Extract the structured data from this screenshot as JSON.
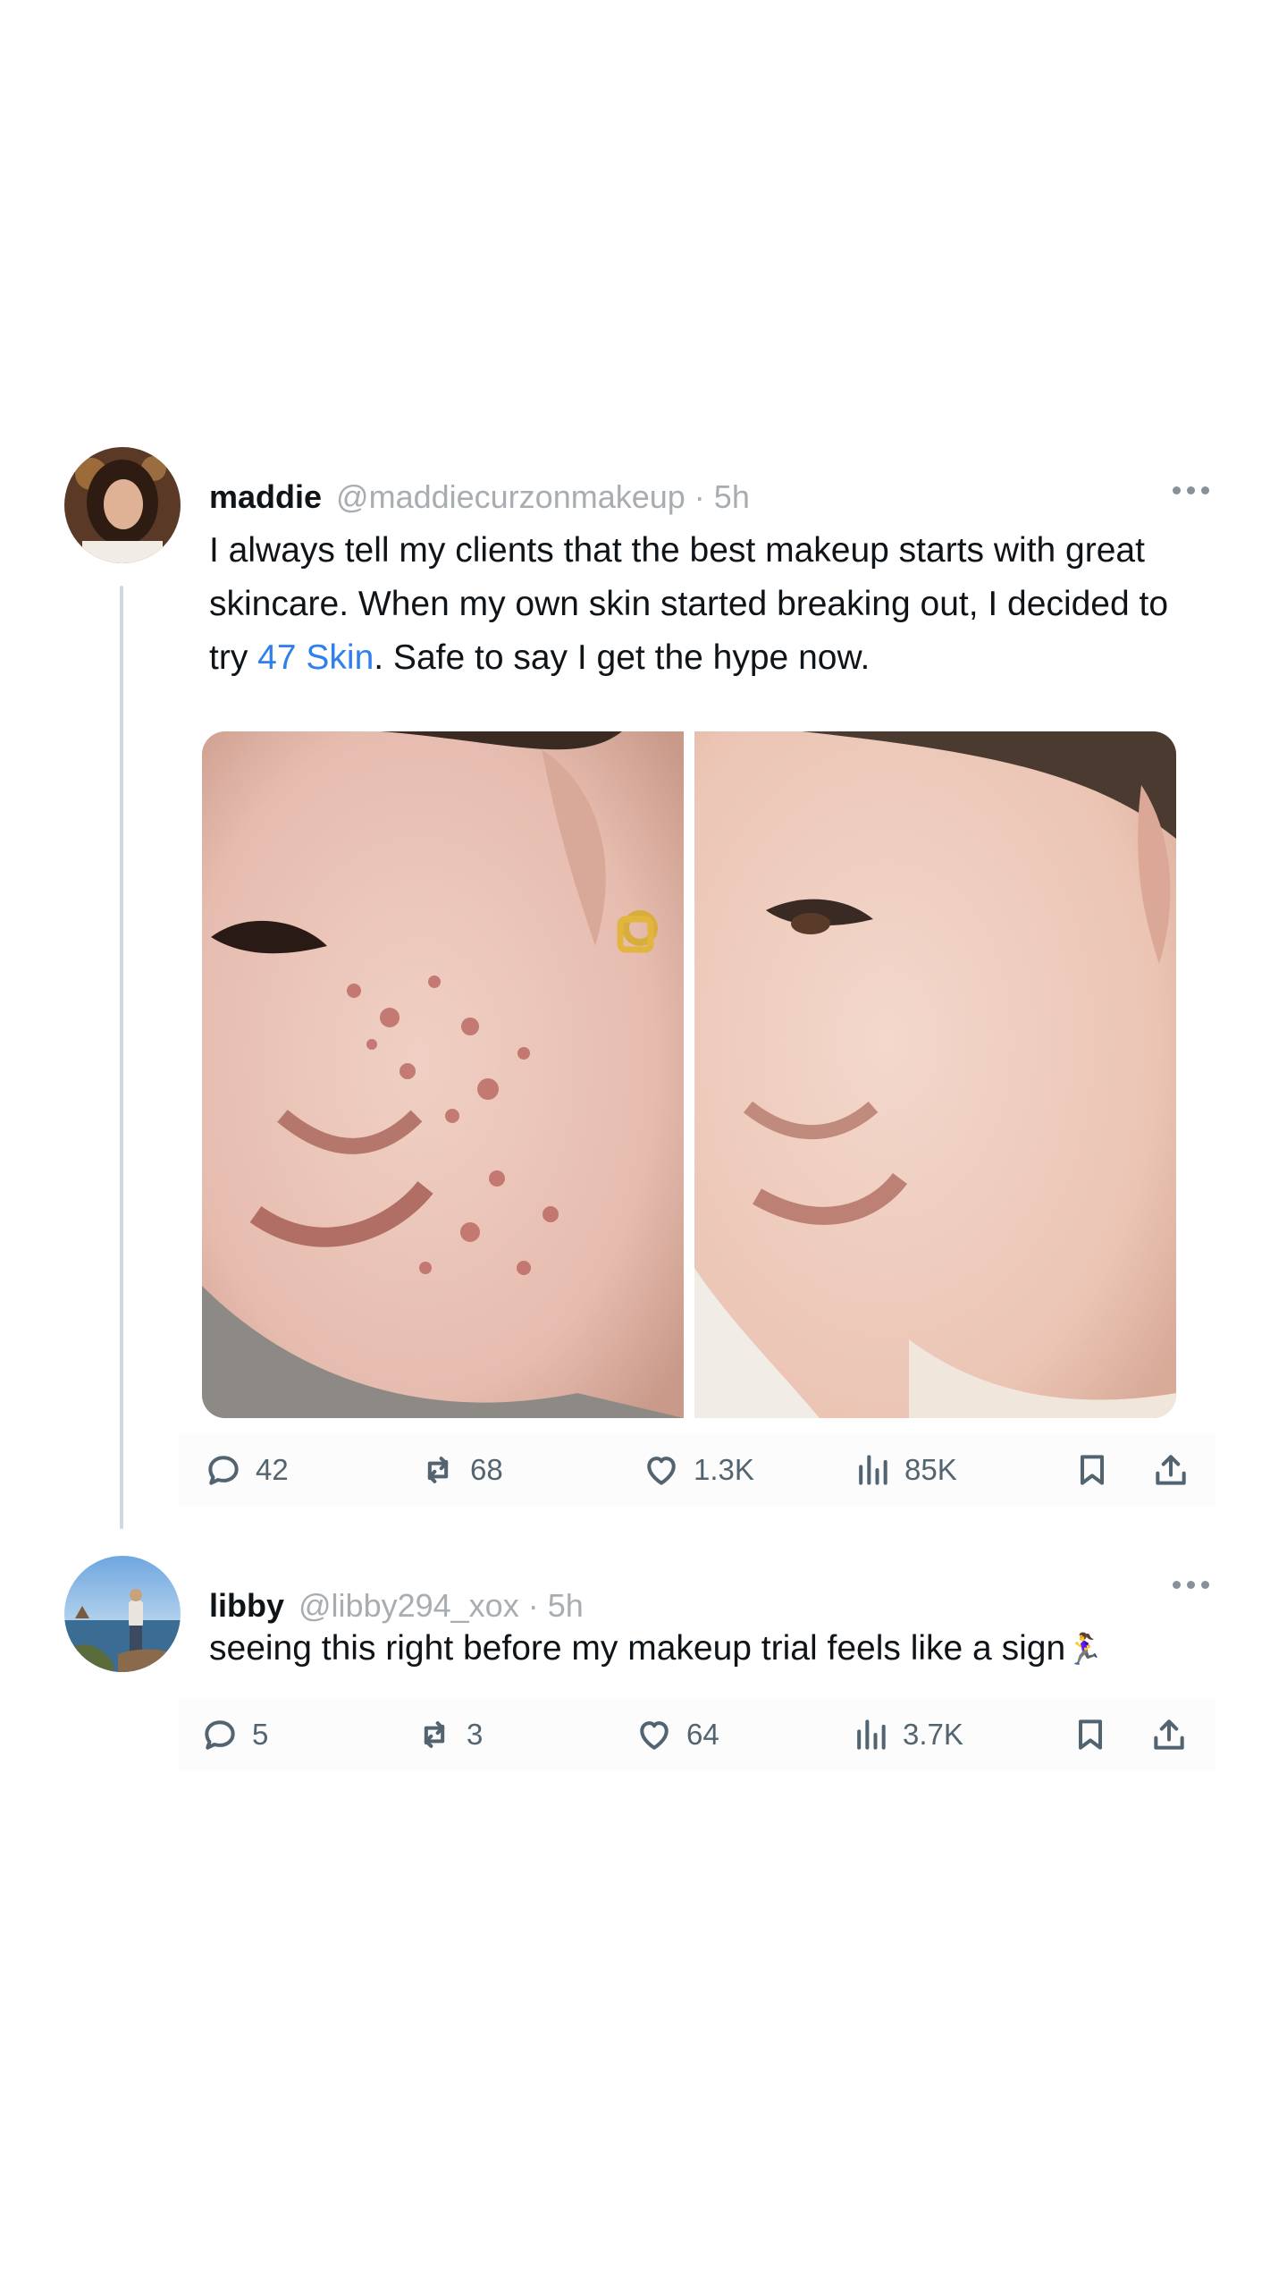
{
  "posts": [
    {
      "display_name": "maddie",
      "handle": "@maddiecurzonmakeup",
      "separator": "·",
      "time": "5h",
      "text_before": "I always tell my clients that the best makeup starts with great skincare. When my own skin started breaking out, I decided to try ",
      "link_text": "47 Skin",
      "text_after": ". Safe to say I get the hype now.",
      "media": [
        "before-photo",
        "after-photo"
      ],
      "stats": {
        "replies": "42",
        "reposts": "68",
        "likes": "1.3K",
        "views": "85K"
      }
    },
    {
      "display_name": "libby",
      "handle": "@libby294_xox",
      "separator": "·",
      "time": "5h",
      "text": "seeing this right before my makeup trial feels like a sign",
      "emoji": "🏃‍♀️",
      "stats": {
        "replies": "5",
        "reposts": "3",
        "likes": "64",
        "views": "3.7K"
      }
    }
  ],
  "icons": {
    "reply": "speech-bubble-icon",
    "repost": "repost-arrows-icon",
    "like": "heart-icon",
    "views": "bar-chart-icon",
    "bookmark": "bookmark-icon",
    "share": "share-upload-icon",
    "more": "ellipsis-icon"
  },
  "colors": {
    "link": "#2f80ed",
    "muted": "#a8adb2",
    "icon": "#536471"
  }
}
